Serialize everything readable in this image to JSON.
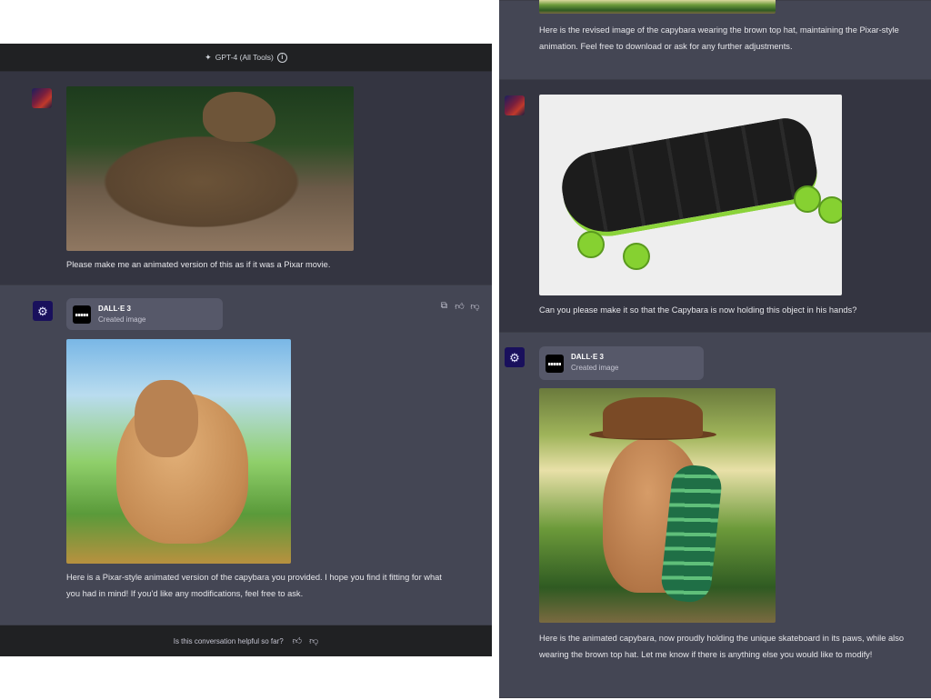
{
  "header": {
    "model_label": "GPT-4 (All Tools)"
  },
  "left": {
    "user_msg": "Please make me an animated version of this as if it was a Pixar movie.",
    "dalle_card": {
      "title": "DALL·E 3",
      "subtitle": "Created image"
    },
    "assistant_msg": "Here is a Pixar-style animated version of the capybara you provided. I hope you find it fitting for what you had in mind! If you'd like any modifications, feel free to ask.",
    "actions": [
      "copy-icon",
      "thumbs-up-icon",
      "thumbs-down-icon"
    ],
    "footer": {
      "question": "Is this conversation helpful so far?"
    }
  },
  "right": {
    "assistant_top_msg": "Here is the revised image of the capybara wearing the brown top hat, maintaining the Pixar-style animation. Feel free to download or ask for any further adjustments.",
    "user_msg": "Can you please make it so that the Capybara is now holding this object in his hands?",
    "dalle_card": {
      "title": "DALL·E 3",
      "subtitle": "Created image"
    },
    "assistant_msg": "Here is the animated capybara, now proudly holding the unique skateboard in its paws, while also wearing the brown top hat. Let me know if there is anything else you would like to modify!"
  },
  "colors": {
    "panel_bg": "#343541",
    "assistant_bg": "#444654",
    "header_bg": "#202123",
    "card_bg": "#565869"
  }
}
